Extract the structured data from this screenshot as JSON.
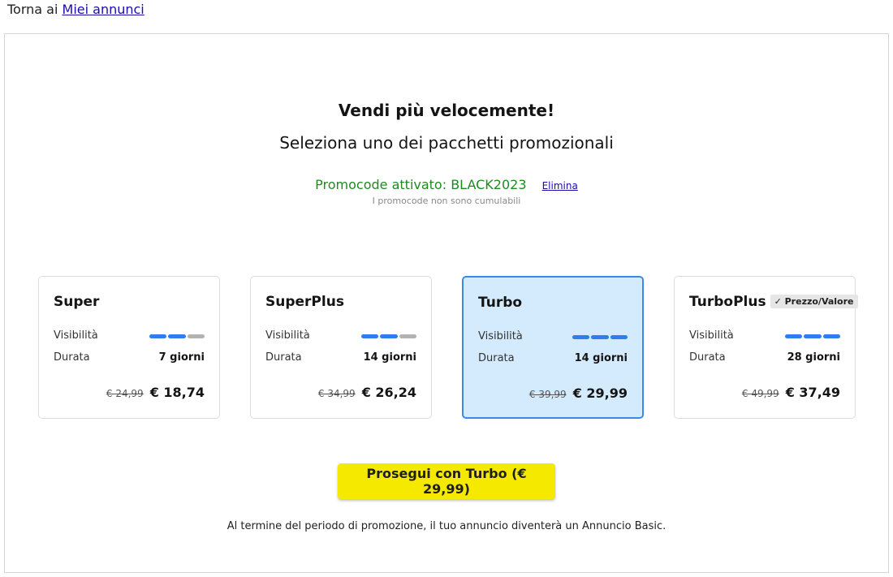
{
  "back": {
    "prefix": "Torna ai",
    "link_label": "Miei annunci"
  },
  "header": {
    "title": "Vendi più velocemente!",
    "subtitle": "Seleziona uno dei pacchetti promozionali"
  },
  "promo": {
    "status": "Promocode attivato: BLACK2023",
    "remove_label": "Elimina",
    "note": "I promocode non sono cumulabili",
    "color": "#1f8a1f"
  },
  "labels": {
    "visibility": "Visibilità",
    "duration": "Durata"
  },
  "packages": [
    {
      "name": "Super",
      "badge": "",
      "visibility_level": 2,
      "visibility_max": 3,
      "duration": "7 giorni",
      "old_price": "€ 24,99",
      "price": "€ 18,74",
      "selected": false
    },
    {
      "name": "SuperPlus",
      "badge": "",
      "visibility_level": 2,
      "visibility_max": 3,
      "duration": "14 giorni",
      "old_price": "€ 34,99",
      "price": "€ 26,24",
      "selected": false
    },
    {
      "name": "Turbo",
      "badge": "",
      "visibility_level": 3,
      "visibility_max": 3,
      "duration": "14 giorni",
      "old_price": "€ 39,99",
      "price": "€ 29,99",
      "selected": true
    },
    {
      "name": "TurboPlus",
      "badge": "✓ Prezzo/Valore",
      "visibility_level": 3,
      "visibility_max": 3,
      "duration": "28 giorni",
      "old_price": "€ 49,99",
      "price": "€ 37,49",
      "selected": false
    }
  ],
  "cta": {
    "label": "Prosegui con Turbo (€ 29,99)",
    "color": "#f5e900"
  },
  "footnote": "Al termine del periodo di promozione, il tuo annuncio diventerà un Annuncio Basic.",
  "colors": {
    "accent": "#2f7df0",
    "selected_bg": "#d4eafd",
    "link": "#1a0dab"
  }
}
